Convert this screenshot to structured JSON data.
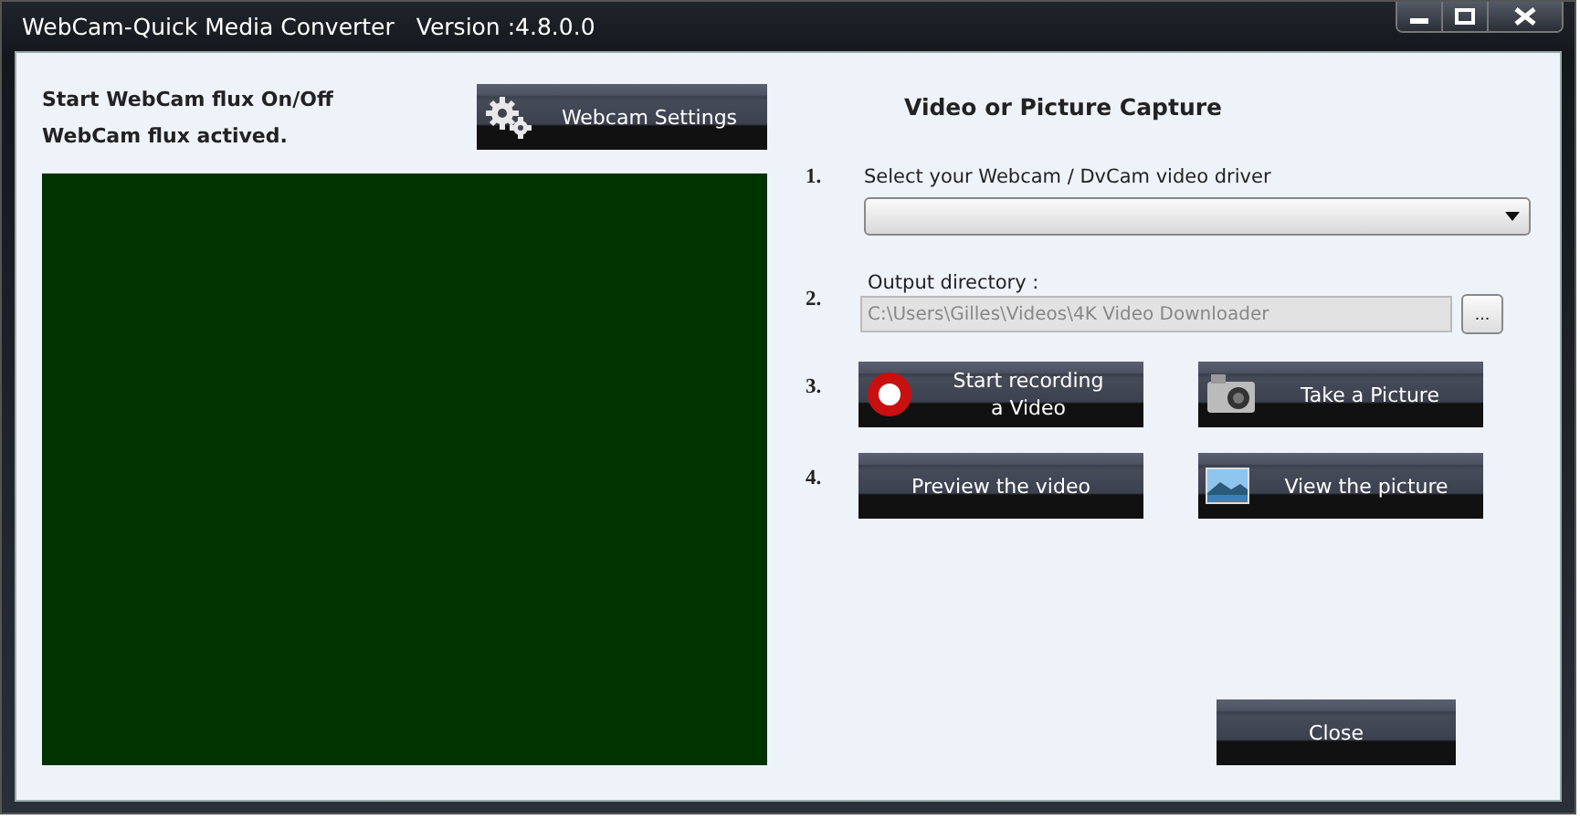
{
  "window": {
    "title": "WebCam-Quick Media Converter",
    "version": "Version :4.8.0.0"
  },
  "left": {
    "status_lines": [
      "Start WebCam flux On/Off",
      "WebCam flux actived."
    ],
    "settings_button": {
      "label": "Webcam Settings",
      "kind": "gears"
    }
  },
  "capture": {
    "heading": "Video or Picture Capture",
    "step1": {
      "number": "1.",
      "label": "Select your Webcam / DvCam video driver"
    },
    "step2": {
      "number": "2.",
      "label": "Output directory :",
      "value": "C:\\Users\\Gilles\\Videos\\4K Video Downloader",
      "disabled": true,
      "browse_label": "..."
    },
    "step3": {
      "number": "3.",
      "buttons": [
        {
          "label": "Start recording\na Video",
          "kind": "record"
        },
        {
          "label": "Take a Picture",
          "kind": "camera"
        }
      ]
    },
    "step4": {
      "number": "4.",
      "buttons": [
        {
          "label": "Preview the video",
          "kind": "plain"
        },
        {
          "label": "View the picture"
        }
      ]
    }
  },
  "close_button": {
    "label": "Close"
  }
}
